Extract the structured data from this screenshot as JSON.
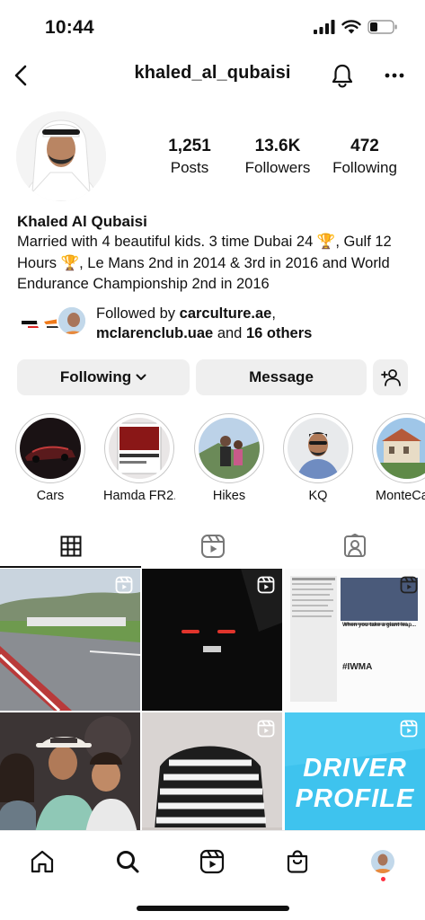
{
  "status_bar": {
    "time": "10:44"
  },
  "header": {
    "username": "khaled_al_qubaisi"
  },
  "stats": {
    "posts": {
      "value": "1,251",
      "label": "Posts"
    },
    "followers": {
      "value": "13.6K",
      "label": "Followers"
    },
    "following": {
      "value": "472",
      "label": "Following"
    }
  },
  "profile": {
    "full_name": "Khaled Al Qubaisi",
    "bio": "Married with 4 beautiful kids. 3 time Dubai 24 🏆, Gulf 12 Hours 🏆, Le Mans 2nd in 2014 & 3rd in 2016 and World Endurance Championship 2nd in 2016"
  },
  "followed_by": {
    "prefix": "Followed by ",
    "user1": "carculture.ae",
    "sep": ",",
    "user2": "mclarenclub.uae",
    "and": " and ",
    "others": "16 others"
  },
  "actions": {
    "following_label": "Following",
    "message_label": "Message"
  },
  "highlights": [
    {
      "label": "Cars"
    },
    {
      "label": "Hamda FR2..."
    },
    {
      "label": "Hikes"
    },
    {
      "label": "KQ"
    },
    {
      "label": "MonteCa"
    }
  ],
  "posts": [
    {
      "type": "reel"
    },
    {
      "type": "reel"
    },
    {
      "type": "reel",
      "text_title": "When you take a giant leap...",
      "hashtag": "#IWMA"
    },
    {
      "type": "photo"
    },
    {
      "type": "reel"
    },
    {
      "type": "reel",
      "line1": "DRIVER",
      "line2": "PROFILE"
    }
  ],
  "colors": {
    "notification_dot": "#ff3040",
    "button_bg": "#efefef",
    "driver_profile_bg": "#3ec3ee"
  }
}
